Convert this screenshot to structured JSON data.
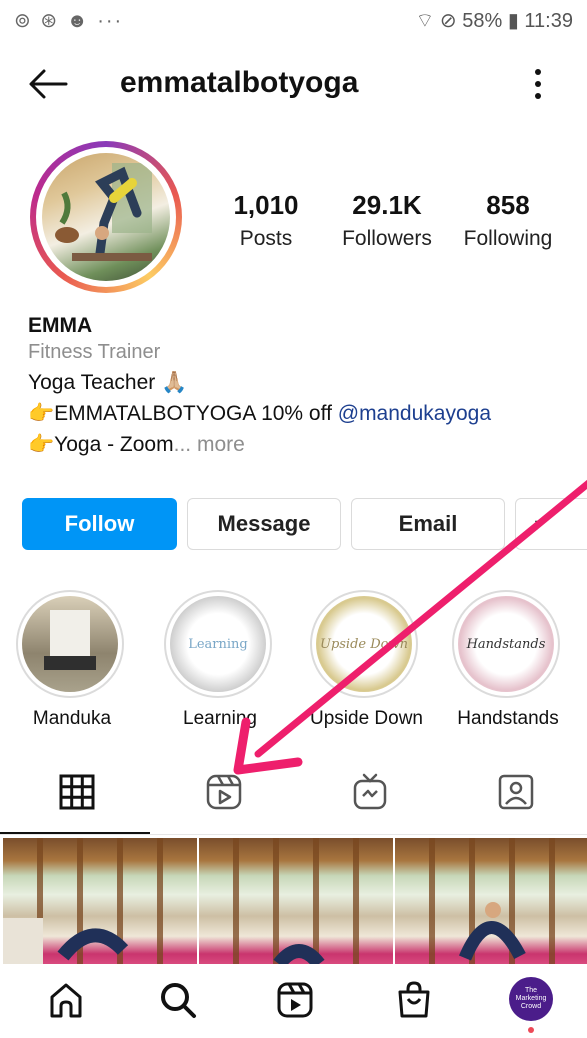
{
  "status_bar": {
    "left_icons": "⊚ ⊛ ☻ ···",
    "battery": "58%",
    "time": "11:39"
  },
  "header": {
    "username": "emmatalbotyoga"
  },
  "stats": [
    {
      "value": "1,010",
      "label": "Posts"
    },
    {
      "value": "29.1K",
      "label": "Followers"
    },
    {
      "value": "858",
      "label": "Following"
    }
  ],
  "bio": {
    "name": "EMMA",
    "category": "Fitness Trainer",
    "line1": "Yoga Teacher 🙏🏼",
    "line2_prefix": "👉EMMATALBOTYOGA 10% off ",
    "line2_mention": "@mandukayoga",
    "line3_prefix": "👉Yoga - Zoom",
    "line3_more": "... more"
  },
  "buttons": {
    "follow": "Follow",
    "message": "Message",
    "email": "Email",
    "more": "›"
  },
  "highlights": [
    {
      "label": "Manduka",
      "cover_text": ""
    },
    {
      "label": "Learning",
      "cover_text": "Learning"
    },
    {
      "label": "Upside Down",
      "cover_text": "Upside Down"
    },
    {
      "label": "Handstands",
      "cover_text": "Handstands"
    }
  ],
  "nav_avatar_text": "The Marketing Crowd",
  "colors": {
    "follow_blue": "#0095f6",
    "annotation_arrow": "#ee1f6c",
    "mention": "#1d3f8f"
  }
}
